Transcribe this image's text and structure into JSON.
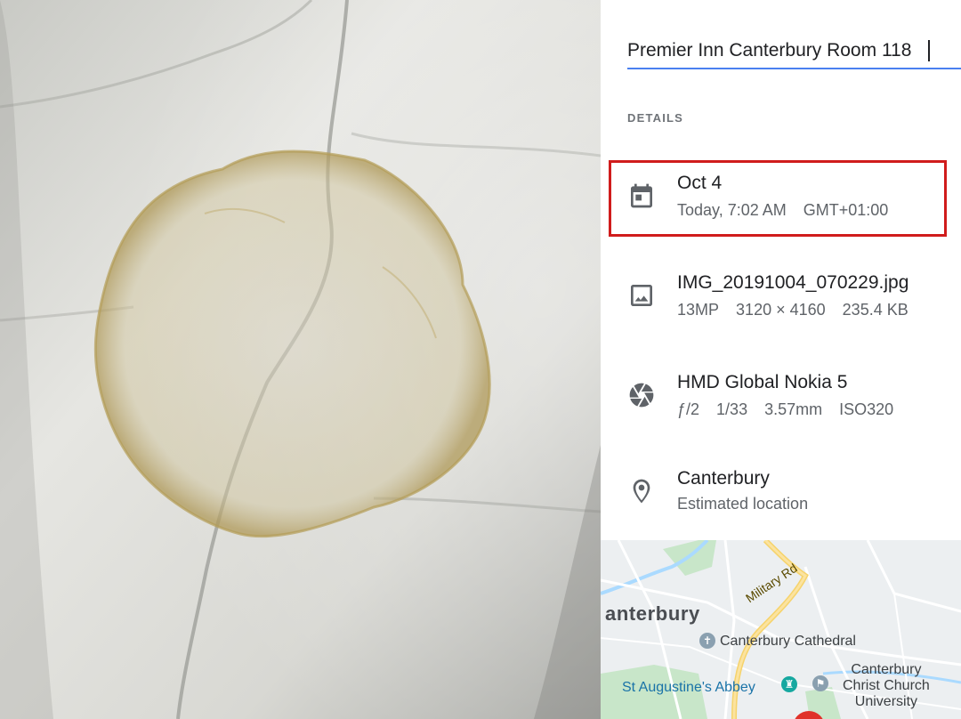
{
  "photo": {
    "description_icon": "photo-viewer-image"
  },
  "title_input": {
    "value": "Premier Inn Canterbury Room 118"
  },
  "details": {
    "section_label": "DETAILS",
    "date": {
      "icon": "calendar-icon",
      "primary": "Oct 4",
      "time": "Today, 7:02 AM",
      "timezone": "GMT+01:00"
    },
    "file": {
      "icon": "image-icon",
      "primary": "IMG_20191004_070229.jpg",
      "megapixels": "13MP",
      "dimensions": "3120 × 4160",
      "size": "235.4 KB"
    },
    "camera": {
      "icon": "aperture-icon",
      "primary": "HMD Global Nokia 5",
      "aperture": "ƒ/2",
      "shutter": "1/33",
      "focal_length": "3.57mm",
      "iso": "ISO320"
    },
    "location": {
      "icon": "location-pin-icon",
      "primary": "Canterbury",
      "secondary": "Estimated location"
    }
  },
  "map": {
    "city": "anterbury",
    "road": "Military Rd",
    "cathedral": "Canterbury Cathedral",
    "abbey": "St Augustine's Abbey",
    "university_line1": "Canterbury",
    "university_line2": "Christ Church",
    "university_line3": "University"
  },
  "colors": {
    "accent_underline": "#4a80f0",
    "highlight_box": "#d01c1c",
    "map_pin": "#e0322a"
  }
}
